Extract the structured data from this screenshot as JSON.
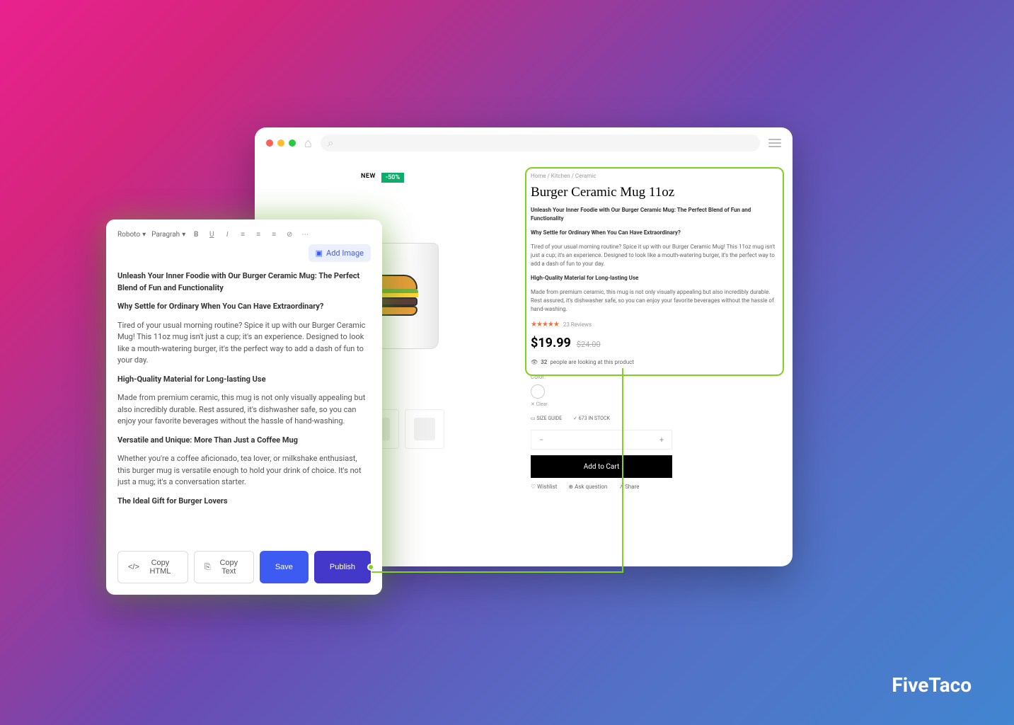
{
  "brand": "FiveTaco",
  "browser": {
    "search_placeholder": ""
  },
  "product": {
    "badge_new": "NEW",
    "badge_sale": "-50%",
    "breadcrumb": "Home  /  Kitchen  /  Ceramic",
    "title": "Burger Ceramic Mug 11oz",
    "desc_heading1": "Unleash Your Inner Foodie with Our Burger Ceramic Mug: The Perfect Blend of Fun and Functionality",
    "desc_heading2": "Why Settle for Ordinary When You Can Have Extraordinary?",
    "desc_para1": "Tired of your usual morning routine? Spice it up with our Burger Ceramic Mug! This 11oz mug isn't just a cup; it's an experience. Designed to look like a mouth-watering burger, it's the perfect way to add a dash of fun to your day.",
    "desc_heading3": "High-Quality Material for Long-lasting Use",
    "desc_para2": "Made from premium ceramic, this mug is not only visually appealing but also incredibly durable. Rest assured, it's dishwasher safe, so you can enjoy your favorite beverages without the hassle of hand-washing.",
    "reviews_count": "23 Reviews",
    "price": "$19.99",
    "old_price": "$24.00",
    "viewers": "32",
    "viewers_text": "people are looking at this product",
    "color_label": "Color:",
    "clear": "Clear",
    "size_guide": "SIZE GUIDE",
    "stock": "673 IN STOCK",
    "add_to_cart": "Add to Cart",
    "wishlist": "Wishlist",
    "ask_question": "Ask question",
    "share": "Share"
  },
  "editor": {
    "font": "Roboto",
    "style": "Paragrah",
    "add_image": "Add Image",
    "content": {
      "h1": "Unleash Your Inner Foodie with Our Burger Ceramic Mug: The Perfect Blend of Fun and Functionality",
      "h2": "Why Settle for Ordinary When You Can Have Extraordinary?",
      "p1": "Tired of your usual morning routine? Spice it up with our Burger Ceramic Mug! This 11oz mug isn't just a cup; it's an experience. Designed to look like a mouth-watering burger, it's the perfect way to add a dash of fun to your day.",
      "h3": "High-Quality Material for Long-lasting Use",
      "p2": "Made from premium ceramic, this mug is not only visually appealing but also incredibly durable. Rest assured, it's dishwasher safe, so you can enjoy your favorite beverages without the hassle of hand-washing.",
      "h4": "Versatile and Unique: More Than Just a Coffee Mug",
      "p3": "Whether you're a coffee aficionado, tea lover, or milkshake enthusiast, this burger mug is versatile enough to hold your drink of choice. It's not just a mug; it's a conversation starter.",
      "h5": "The Ideal Gift for Burger Lovers"
    },
    "buttons": {
      "copy_html": "Copy HTML",
      "copy_text": "Copy Text",
      "save": "Save",
      "publish": "Publish"
    }
  }
}
